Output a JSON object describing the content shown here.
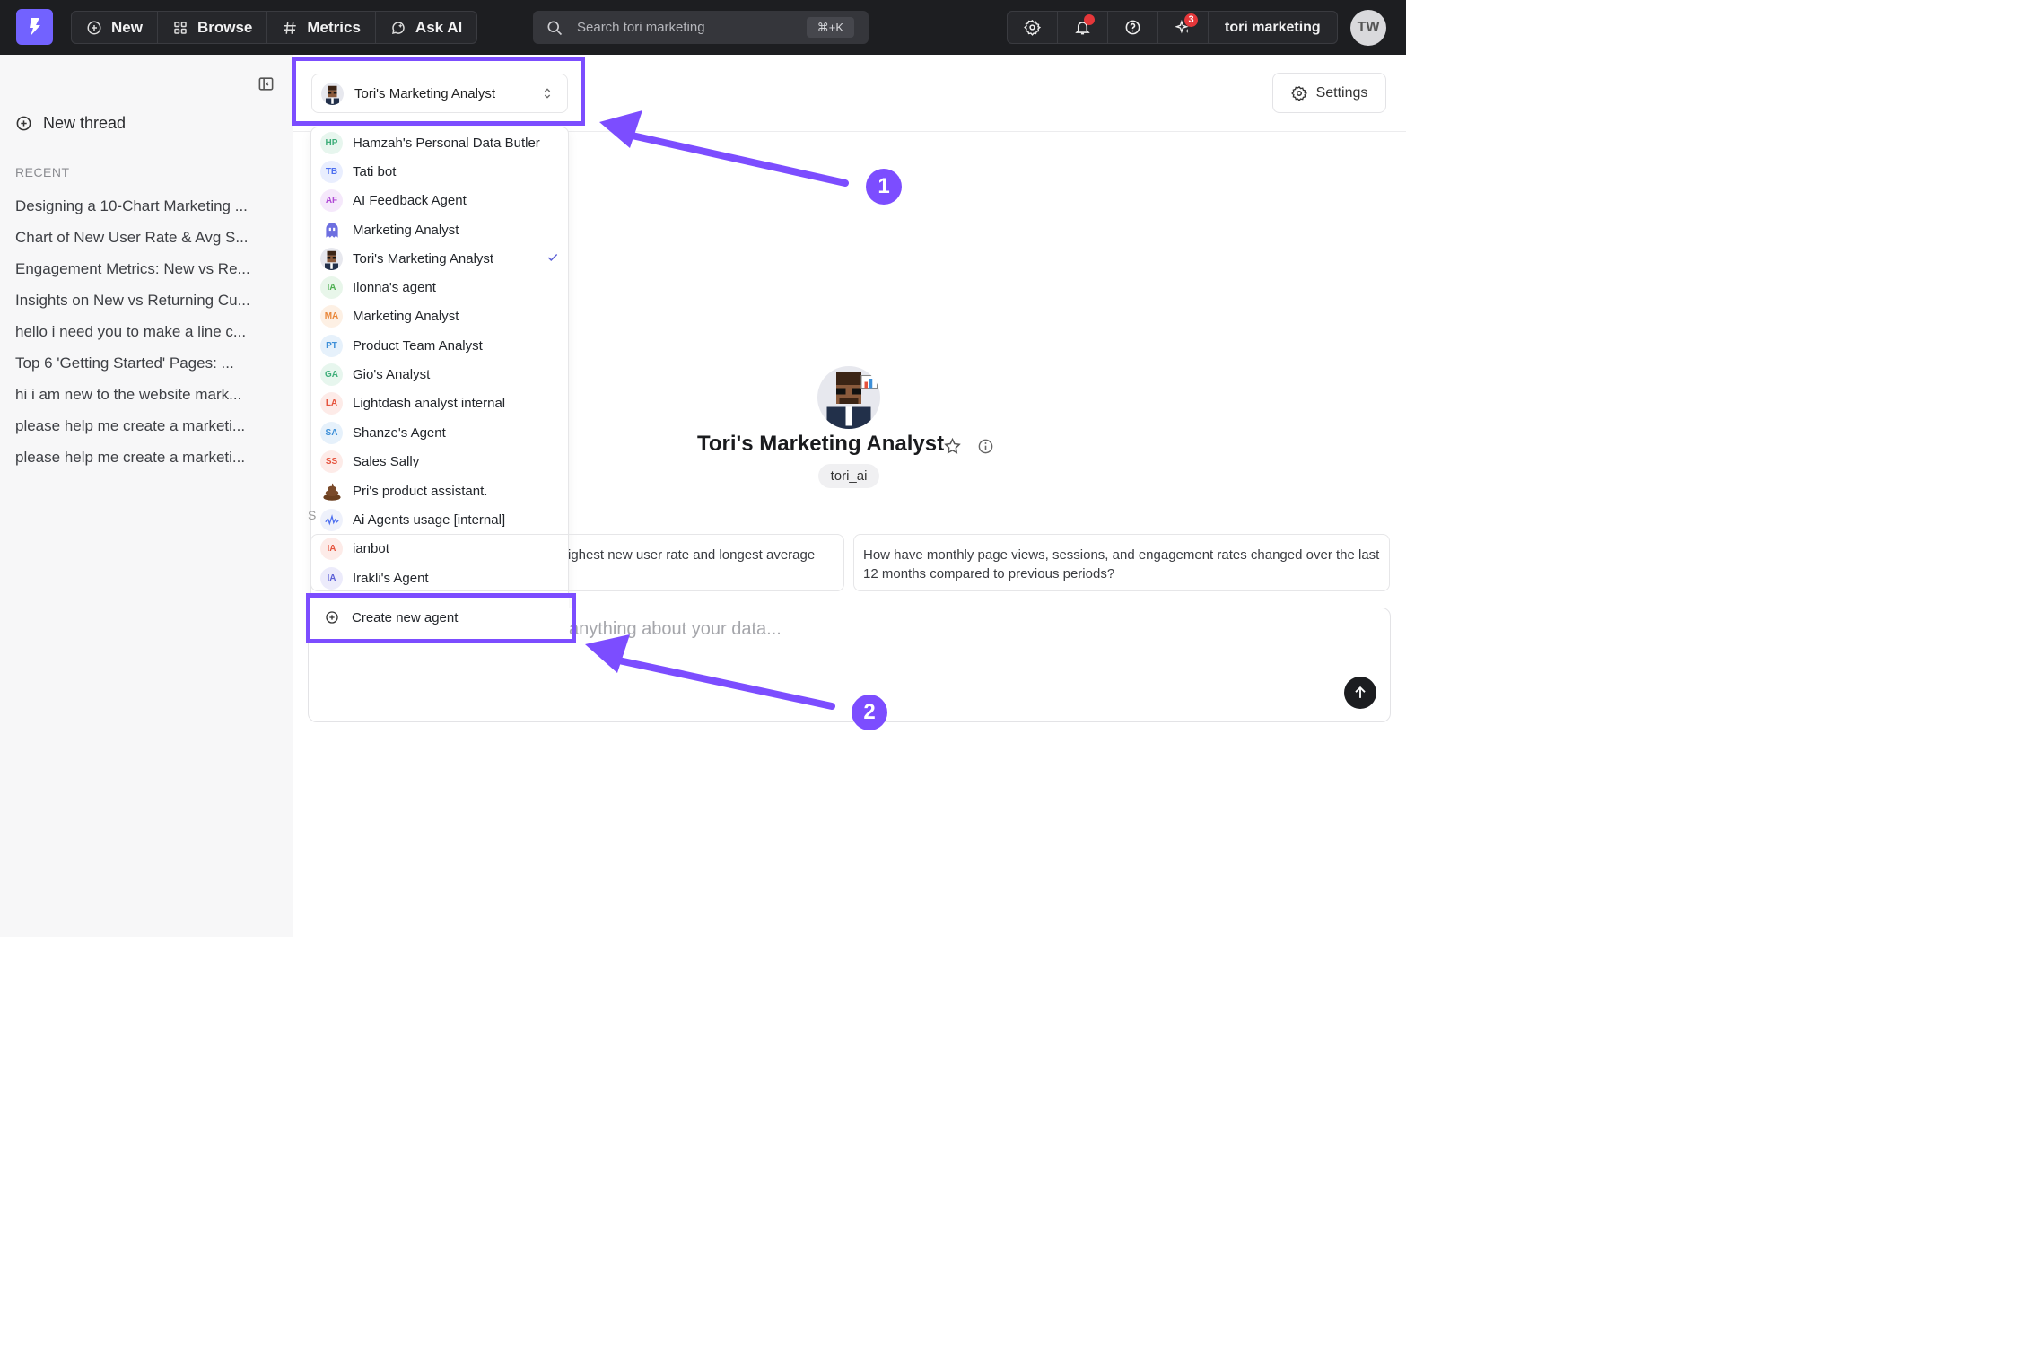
{
  "topbar": {
    "nav": [
      {
        "label": "New",
        "icon": "plus-circle-icon"
      },
      {
        "label": "Browse",
        "icon": "grid-icon"
      },
      {
        "label": "Metrics",
        "icon": "hash-icon"
      },
      {
        "label": "Ask AI",
        "icon": "ai-chat-icon"
      }
    ],
    "search_placeholder": "Search tori marketing",
    "search_shortcut": "⌘+K",
    "ai_badge_count": "3",
    "org_name": "tori marketing",
    "user_initials": "TW"
  },
  "sidebar": {
    "new_thread_label": "New thread",
    "recent_heading": "RECENT",
    "threads": [
      "Designing a 10-Chart Marketing ...",
      "Chart of New User Rate & Avg S...",
      "Engagement Metrics: New vs Re...",
      "Insights on New vs Returning Cu...",
      "hello i need you to make a line c...",
      "Top 6 'Getting Started' Pages: ...",
      "hi i am new to the website mark...",
      "please help me create a marketi...",
      "please help me create a marketi..."
    ]
  },
  "header": {
    "selected_agent": "Tori's Marketing Analyst",
    "settings_label": "Settings"
  },
  "dropdown": {
    "agents": [
      {
        "initials": "HP",
        "name": "Hamzah's Personal Data Butler",
        "color": "#3fae7a",
        "bg": "#e7f6ee"
      },
      {
        "initials": "TB",
        "name": "Tati bot",
        "color": "#4d6ff0",
        "bg": "#e9eefe"
      },
      {
        "initials": "AF",
        "name": "AI Feedback Agent",
        "color": "#b04ad6",
        "bg": "#f5e8fb"
      },
      {
        "initials": "",
        "name": "Marketing Analyst",
        "color": "#5b5fd6",
        "bg": "#ffffff"
      },
      {
        "initials": "",
        "name": "Tori's Marketing Analyst",
        "color": "#333333",
        "bg": "#e7e8ee"
      },
      {
        "initials": "IA",
        "name": "Ilonna's agent",
        "color": "#4caf50",
        "bg": "#e8f6ea"
      },
      {
        "initials": "MA",
        "name": "Marketing Analyst",
        "color": "#e9873a",
        "bg": "#fdf0e4"
      },
      {
        "initials": "PT",
        "name": "Product Team Analyst",
        "color": "#3d8fd8",
        "bg": "#e6f1fb"
      },
      {
        "initials": "GA",
        "name": "Gio's Analyst",
        "color": "#3fae7a",
        "bg": "#e7f6ee"
      },
      {
        "initials": "LA",
        "name": "Lightdash analyst internal",
        "color": "#e5533d",
        "bg": "#fdebe8"
      },
      {
        "initials": "SA",
        "name": "Shanze's Agent",
        "color": "#3d8fd8",
        "bg": "#e6f1fb"
      },
      {
        "initials": "SS",
        "name": "Sales Sally",
        "color": "#e5533d",
        "bg": "#fdebe8"
      },
      {
        "initials": "",
        "name": "Pri's product assistant.",
        "color": "#7a4a2a",
        "bg": "#ffffff"
      },
      {
        "initials": "",
        "name": "Ai Agents usage [internal]",
        "color": "#4d6ff0",
        "bg": "#eef1fb"
      },
      {
        "initials": "IA",
        "name": "ianbot",
        "color": "#e5533d",
        "bg": "#fdebe8"
      },
      {
        "initials": "IA",
        "name": "Irakli's Agent",
        "color": "#5b5fd6",
        "bg": "#ecebfb"
      }
    ],
    "selected_index": 4,
    "create_label": "Create new agent"
  },
  "agent": {
    "name": "Tori's Marketing Analyst",
    "slug": "tori_ai"
  },
  "suggestions": [
    "ighest new user rate and longest average",
    "How have monthly page views, sessions, and engagement rates changed over the last 12 months compared to previous periods?"
  ],
  "chat": {
    "placeholder": "anything about your data...",
    "left_fragment": "S"
  },
  "annotations": {
    "callout_1": "1",
    "callout_2": "2",
    "accent": "#7c4dff"
  },
  "colors": {
    "topbar_bg": "#1d1e21",
    "brand": "#7262ff"
  }
}
